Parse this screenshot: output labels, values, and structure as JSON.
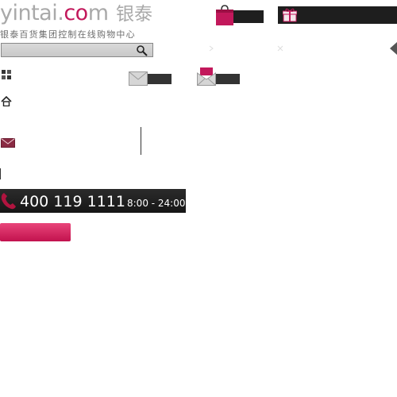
{
  "header": {
    "logo": {
      "text_main": "yintai.",
      "text_accent": "co",
      "text_suffix": "m",
      "cn_name": "银泰"
    },
    "tagline": "银泰百货集团控制在线购物中心"
  },
  "search": {
    "value": "",
    "placeholder": ""
  },
  "contact": {
    "phone_number": "400 119 1111",
    "hours": "8:00 - 24:00"
  },
  "pink_button": {
    "label": ""
  },
  "colors": {
    "accent": "#c2185b",
    "dark_bar": "#1e1e1e",
    "logo_grey": "#a9a9a9"
  },
  "icons": [
    "search-icon",
    "shopping-bag-icon",
    "gift-icon",
    "plus-icon",
    "home-icon",
    "mail-icon",
    "envelope-icon",
    "open-envelope-icon",
    "phone-icon",
    "arrow-icon",
    "close-icon",
    "triangle-left-icon"
  ]
}
